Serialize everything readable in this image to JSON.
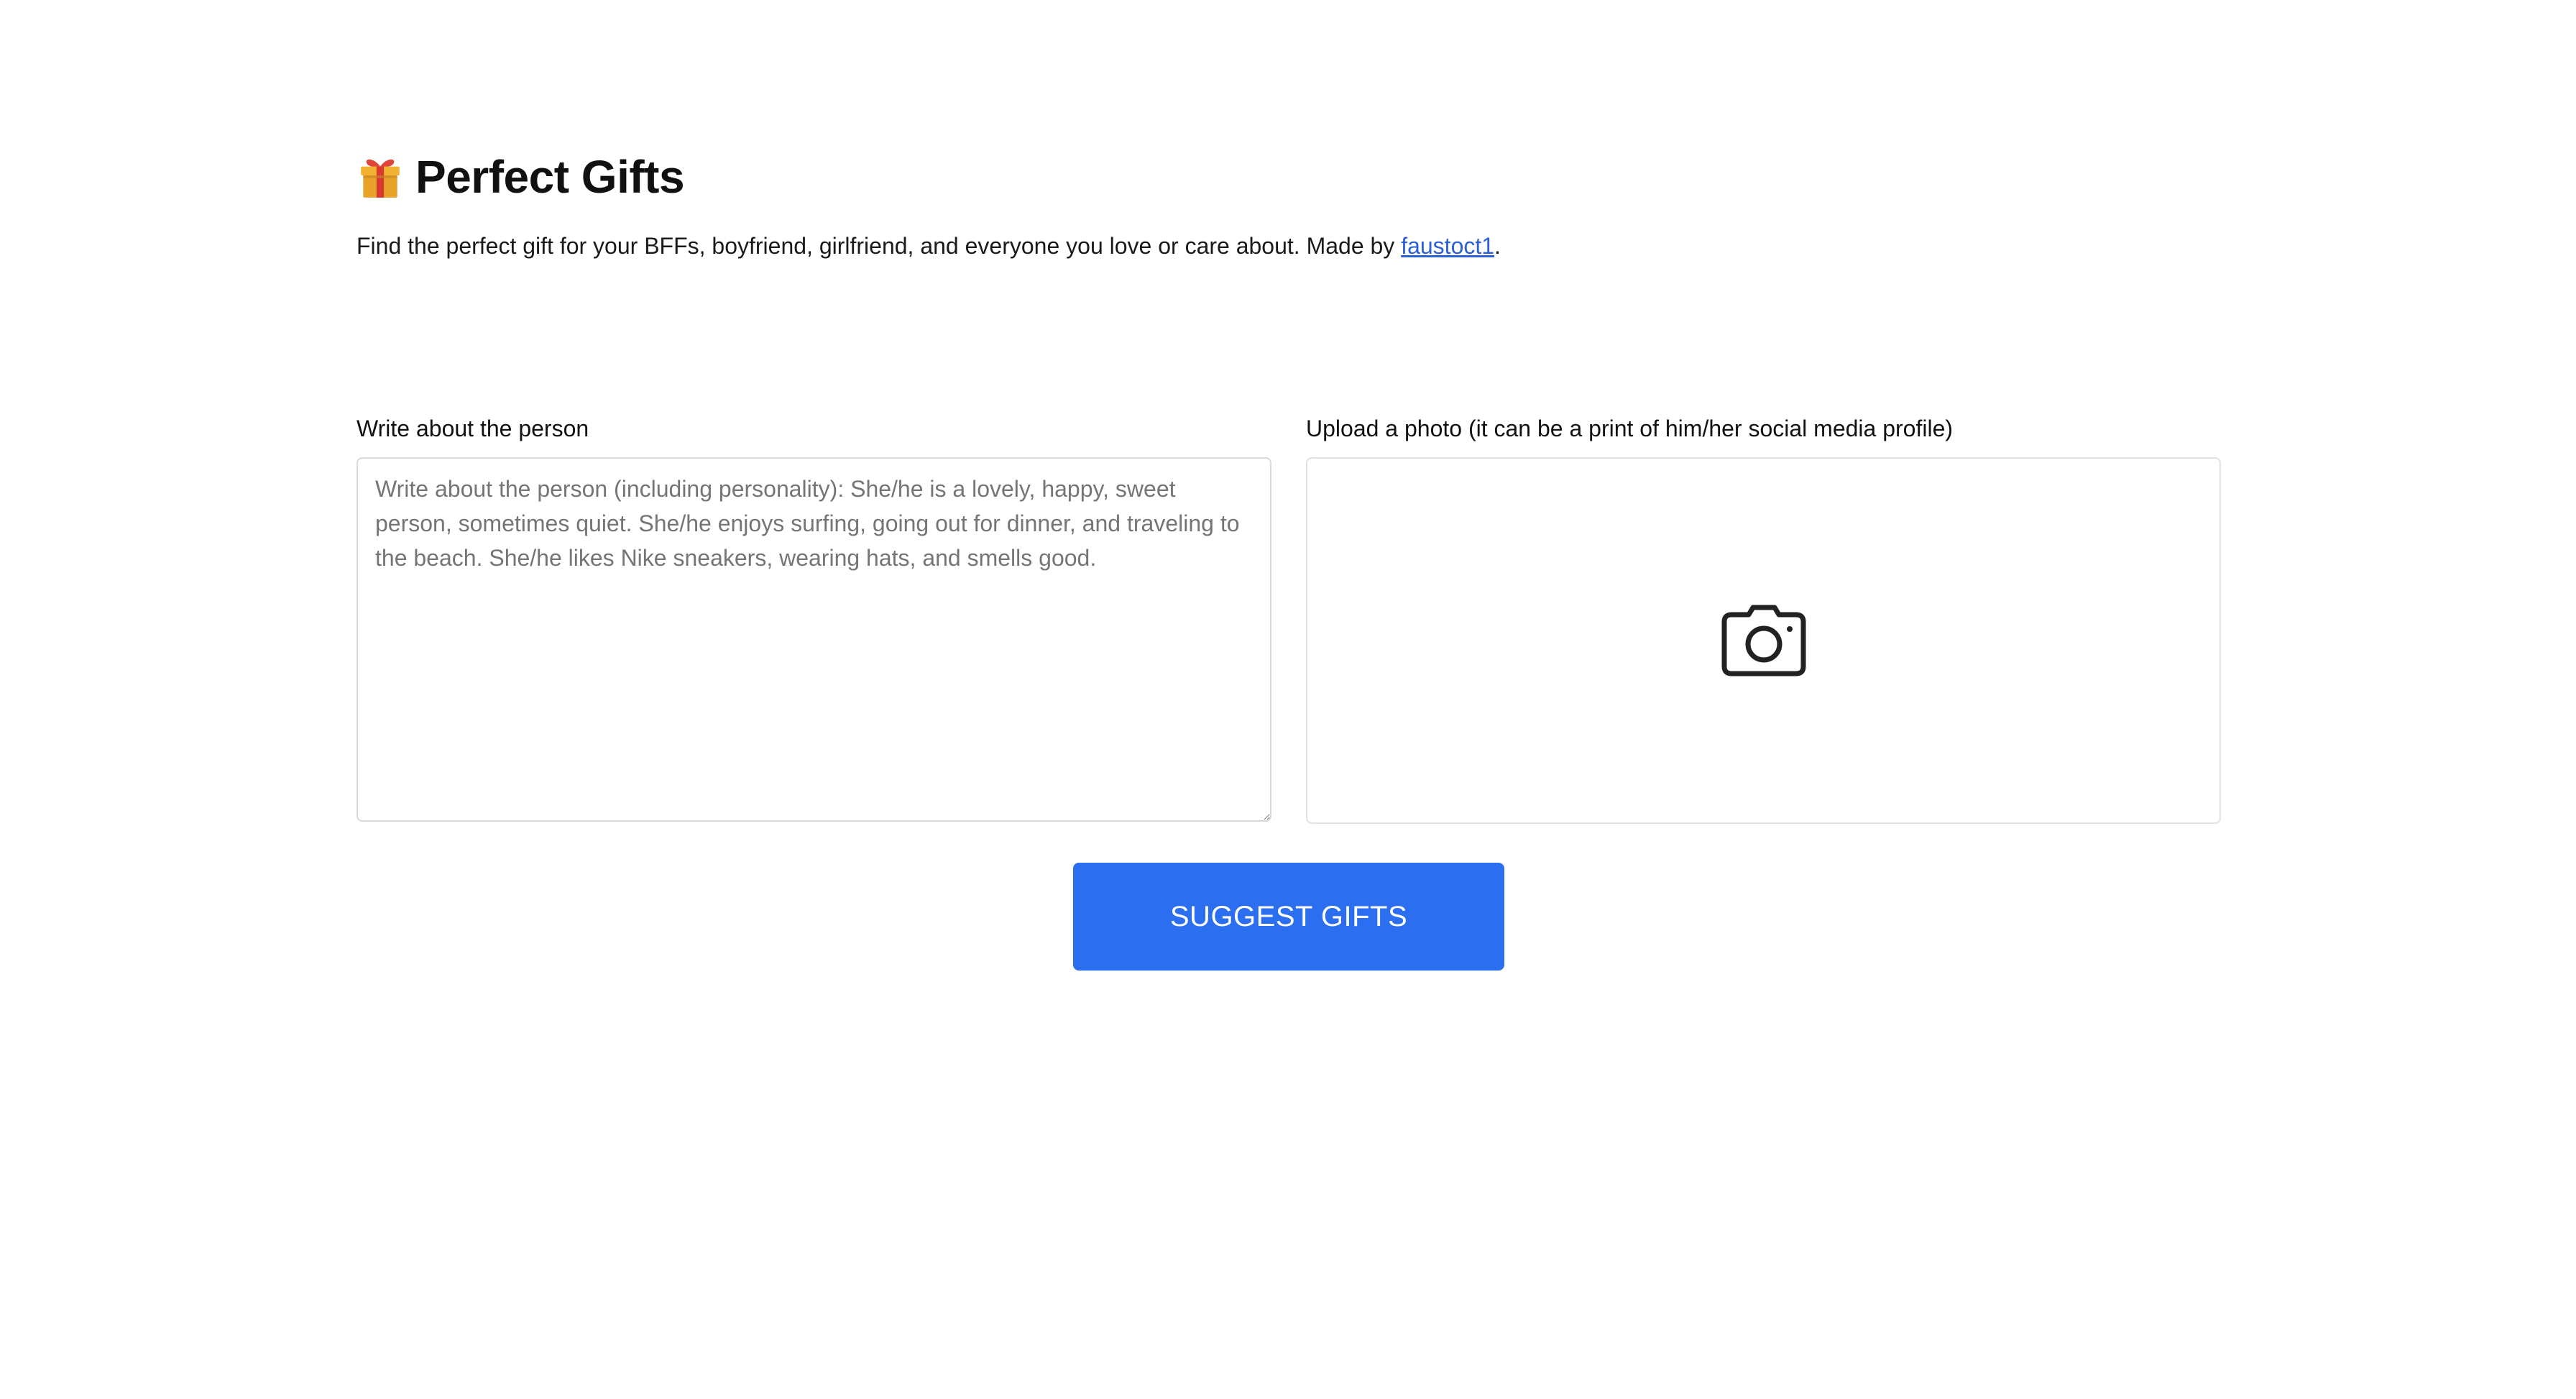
{
  "header": {
    "icon": "gift-icon",
    "title": "Perfect Gifts",
    "subtitle_prefix": "Find the perfect gift for your BFFs, boyfriend, girlfriend, and everyone you love or care about. Made by ",
    "author_link": "faustoct1",
    "subtitle_suffix": "."
  },
  "form": {
    "description_label": "Write about the person",
    "description_placeholder": "Write about the person (including personality): She/he is a lovely, happy, sweet person, sometimes quiet. She/he enjoys surfing, going out for dinner, and traveling to the beach. She/he likes Nike sneakers, wearing hats, and smells good.",
    "description_value": "",
    "upload_label": "Upload a photo (it can be a print of him/her social media profile)",
    "upload_icon": "camera-icon"
  },
  "actions": {
    "suggest_label": "SUGGEST GIFTS"
  },
  "colors": {
    "accent": "#2b6ff0",
    "link": "#2c5fd6",
    "border": "#d9d9d9"
  }
}
